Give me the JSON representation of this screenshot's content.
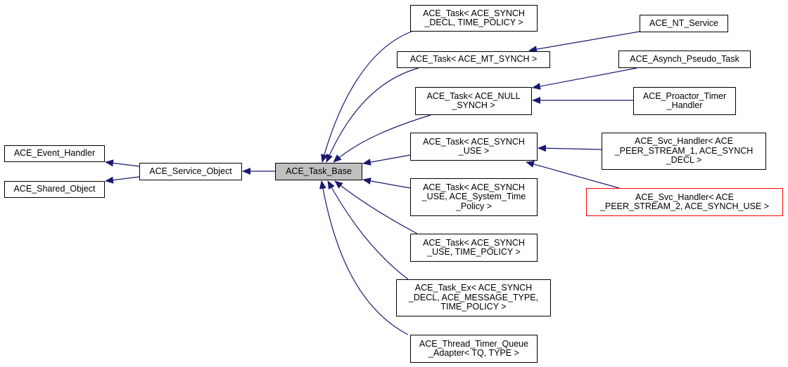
{
  "diagram": {
    "type": "inheritance-graph",
    "edge_color": "#191970",
    "current_node_fill": "#bfbfbf",
    "highlight_border_color": "#ff0000",
    "nodes": [
      {
        "id": "event_handler",
        "label": "ACE_Event_Handler"
      },
      {
        "id": "shared_object",
        "label": "ACE_Shared_Object"
      },
      {
        "id": "service_object",
        "label": "ACE_Service_Object"
      },
      {
        "id": "task_base",
        "label": "ACE_Task_Base",
        "current": true
      },
      {
        "id": "task_synch_decl_tp",
        "label": "ACE_Task< ACE_SYNCH\n_DECL, TIME_POLICY >"
      },
      {
        "id": "task_mt_synch",
        "label": "ACE_Task< ACE_MT_SYNCH >"
      },
      {
        "id": "task_null_synch",
        "label": "ACE_Task< ACE_NULL\n_SYNCH >"
      },
      {
        "id": "task_synch_use",
        "label": "ACE_Task< ACE_SYNCH\n_USE >"
      },
      {
        "id": "task_synch_use_stp",
        "label": "ACE_Task< ACE_SYNCH\n_USE, ACE_System_Time\n_Policy >"
      },
      {
        "id": "task_synch_use_tp",
        "label": "ACE_Task< ACE_SYNCH\n_USE, TIME_POLICY >"
      },
      {
        "id": "task_ex",
        "label": "ACE_Task_Ex< ACE_SYNCH\n_DECL, ACE_MESSAGE_TYPE,\nTIME_POLICY >"
      },
      {
        "id": "thread_timer_queue_adapter",
        "label": "ACE_Thread_Timer_Queue\n_Adapter< TQ, TYPE >"
      },
      {
        "id": "nt_service",
        "label": "ACE_NT_Service"
      },
      {
        "id": "asynch_pseudo_task",
        "label": "ACE_Asynch_Pseudo_Task"
      },
      {
        "id": "proactor_timer_handler",
        "label": "ACE_Proactor_Timer\n_Handler"
      },
      {
        "id": "svc_handler_1",
        "label": "ACE_Svc_Handler< ACE\n_PEER_STREAM_1, ACE_SYNCH\n_DECL >"
      },
      {
        "id": "svc_handler_2",
        "label": "ACE_Svc_Handler< ACE\n_PEER_STREAM_2, ACE_SYNCH_USE >",
        "highlight": true
      }
    ],
    "edges": [
      {
        "from": "service_object",
        "to": "event_handler"
      },
      {
        "from": "service_object",
        "to": "shared_object"
      },
      {
        "from": "task_base",
        "to": "service_object"
      },
      {
        "from": "task_synch_decl_tp",
        "to": "task_base"
      },
      {
        "from": "task_mt_synch",
        "to": "task_base"
      },
      {
        "from": "task_null_synch",
        "to": "task_base"
      },
      {
        "from": "task_synch_use",
        "to": "task_base"
      },
      {
        "from": "task_synch_use_stp",
        "to": "task_base"
      },
      {
        "from": "task_synch_use_tp",
        "to": "task_base"
      },
      {
        "from": "task_ex",
        "to": "task_base"
      },
      {
        "from": "thread_timer_queue_adapter",
        "to": "task_base"
      },
      {
        "from": "nt_service",
        "to": "task_mt_synch"
      },
      {
        "from": "asynch_pseudo_task",
        "to": "task_null_synch"
      },
      {
        "from": "proactor_timer_handler",
        "to": "task_null_synch"
      },
      {
        "from": "svc_handler_1",
        "to": "task_synch_use"
      },
      {
        "from": "svc_handler_2",
        "to": "task_synch_use"
      }
    ]
  }
}
